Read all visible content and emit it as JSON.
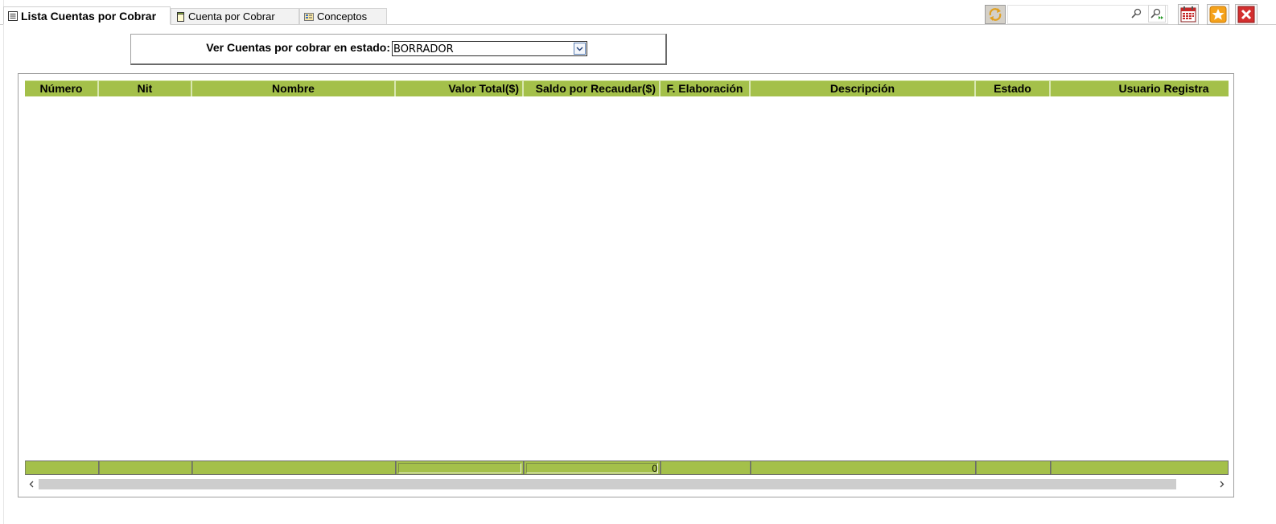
{
  "tabs": [
    {
      "label": "Lista Cuentas por Cobrar",
      "icon": "list-icon",
      "active": true
    },
    {
      "label": "Cuenta por Cobrar",
      "icon": "document-icon",
      "active": false
    },
    {
      "label": "Conceptos",
      "icon": "concepts-icon",
      "active": false
    }
  ],
  "toolbar": {
    "search_value": "",
    "icons": [
      "refresh-icon",
      "search-icon",
      "advanced-search-icon",
      "calendar-icon",
      "favorite-star-icon",
      "close-icon"
    ]
  },
  "filter": {
    "label": "Ver Cuentas por cobrar en estado:",
    "selected": "BORRADOR"
  },
  "grid": {
    "columns": [
      "Número",
      "Nit",
      "Nombre",
      "Valor Total($)",
      "Saldo por Recaudar($)",
      "F. Elaboración",
      "Descripción",
      "Estado",
      "Usuario Registra"
    ],
    "rows": [],
    "footer": {
      "saldo_total": "0"
    }
  },
  "colors": {
    "grid_header": "#a4c04a",
    "border": "#a0a0a0"
  }
}
